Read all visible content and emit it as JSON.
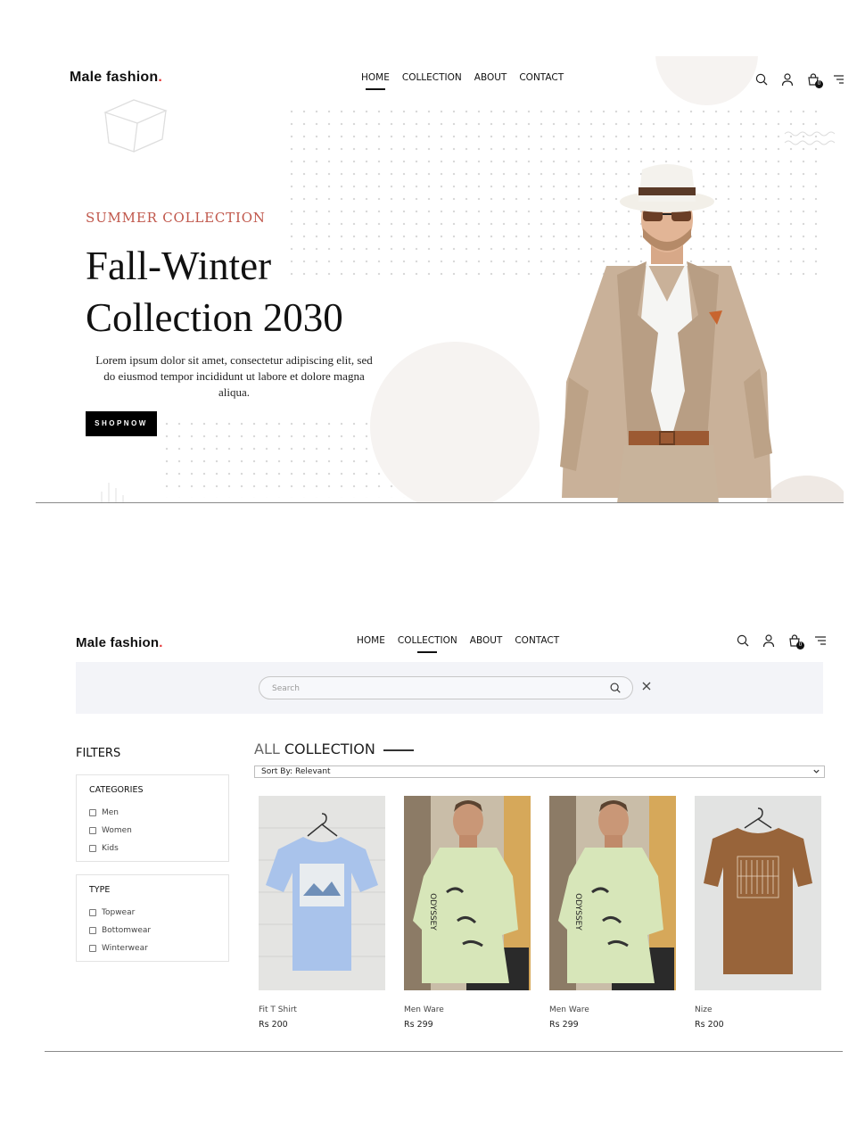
{
  "brand": {
    "name": "Male fashion",
    "dot": "."
  },
  "nav": {
    "home": "HOME",
    "collection": "COLLECTION",
    "about": "ABOUT",
    "contact": "CONTACT"
  },
  "cart_count": "0",
  "hero": {
    "subtitle": "SUMMER COLLECTION",
    "title_line1": "Fall-Winter",
    "title_line2": "Collection 2030",
    "description": "Lorem ipsum dolor sit amet, consectetur adipiscing elit, sed do eiusmod tempor incididunt ut labore et dolore magna aliqua.",
    "button": "SHOPNOW"
  },
  "search": {
    "placeholder": "Search"
  },
  "filters": {
    "title": "FILTERS",
    "categories": {
      "title": "CATEGORIES",
      "options": [
        "Men",
        "Women",
        "Kids"
      ]
    },
    "type": {
      "title": "TYPE",
      "options": [
        "Topwear",
        "Bottomwear",
        "Winterwear"
      ]
    }
  },
  "collection": {
    "title_light": "ALL",
    "title_bold": "COLLECTION",
    "sort_label": "Sort By: Relevant"
  },
  "products": [
    {
      "name": "Fit T Shirt",
      "price": "Rs 200"
    },
    {
      "name": "Men Ware",
      "price": "Rs 299"
    },
    {
      "name": "Men Ware",
      "price": "Rs 299"
    },
    {
      "name": "Nize",
      "price": "Rs 200"
    }
  ],
  "colors": {
    "accent": "#e53637",
    "subtitle": "#c0574b",
    "search_band": "#f3f4f8"
  },
  "icons": [
    "search-icon",
    "user-icon",
    "cart-icon",
    "menu-icon",
    "close-icon",
    "chevron-down-icon"
  ]
}
